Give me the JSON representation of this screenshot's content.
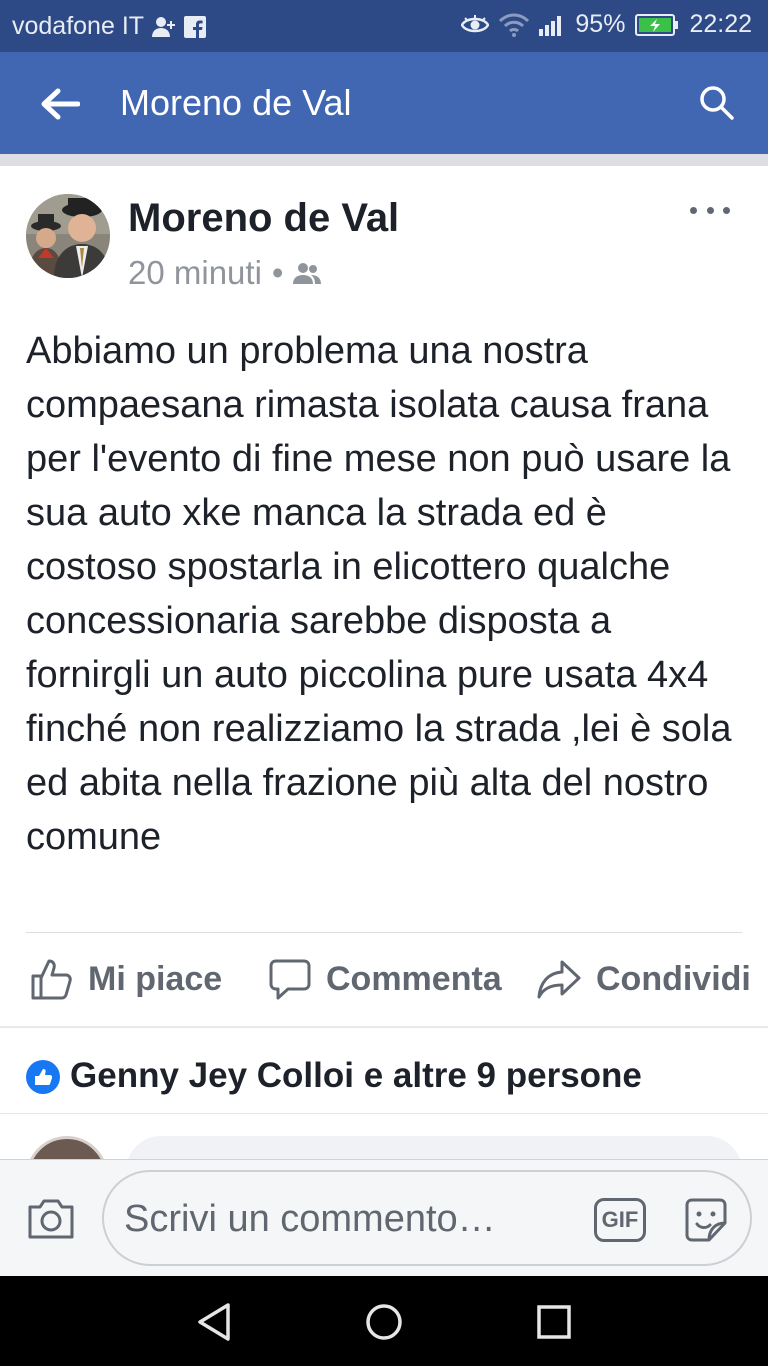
{
  "status_bar": {
    "carrier": "vodafone IT",
    "battery_percent": "95%",
    "time": "22:22",
    "icons": [
      "person-add-icon",
      "facebook-icon",
      "eye-icon",
      "wifi-icon",
      "signal-icon",
      "battery-icon"
    ]
  },
  "app_bar": {
    "title": "Moreno de Val",
    "back_icon": "arrow-left-icon",
    "search_icon": "search-icon"
  },
  "post": {
    "author": "Moreno de Val",
    "time": "20 minuti",
    "separator": "•",
    "privacy_icon": "friends-icon",
    "more_icon": "more-dots-icon",
    "text": "Abbiamo un problema una nostra compaesana rimasta isolata causa frana per l'evento di fine mese  non può usare la sua auto xke manca la strada ed è costoso spostarla in elicottero qualche concessionaria sarebbe disposta a fornirgli un auto piccolina pure usata 4x4  finché non realizziamo la strada ,lei è sola ed abita nella frazione più alta del nostro comune",
    "actions": {
      "like": "Mi piace",
      "comment": "Commenta",
      "share": "Condividi"
    }
  },
  "likes": {
    "text": "Genny Jey Colloi e altre 9 persone"
  },
  "composer": {
    "placeholder": "Scrivi un commento…",
    "gif_label": "GIF"
  },
  "colors": {
    "status_bar": "#2e4a86",
    "app_bar": "#4267b2",
    "like_badge": "#1877f2",
    "text_secondary": "#606770"
  }
}
